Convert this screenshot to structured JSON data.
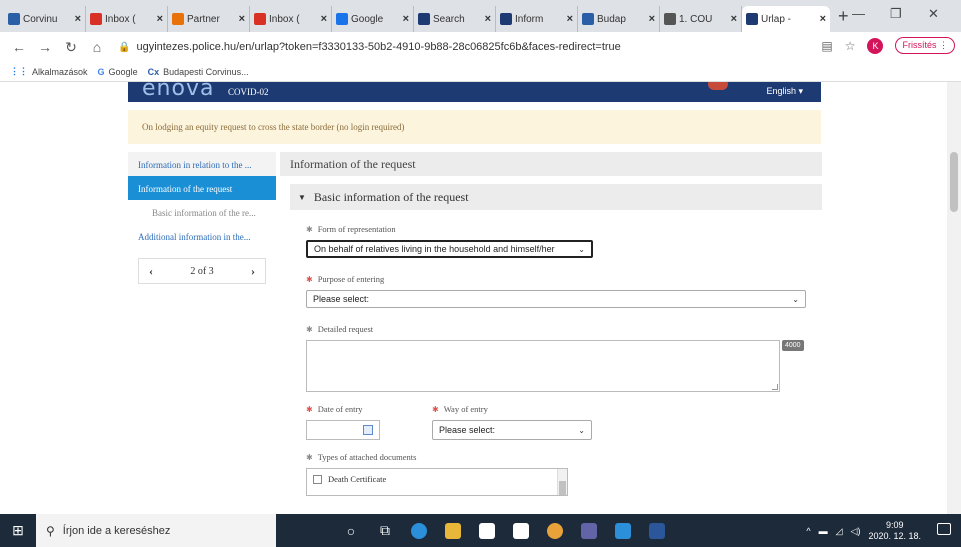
{
  "browser": {
    "tabs": [
      {
        "label": "Corvinu",
        "icon": "corvinus-icon",
        "color": "#2a5fa8"
      },
      {
        "label": "Inbox (",
        "icon": "gmail-icon",
        "color": "#d93025"
      },
      {
        "label": "Partner",
        "icon": "partner-icon",
        "color": "#e8710a"
      },
      {
        "label": "Inbox (",
        "icon": "gmail-icon",
        "color": "#d93025"
      },
      {
        "label": "Google",
        "icon": "google-icon",
        "color": "#1a73e8"
      },
      {
        "label": "Search",
        "icon": "search-icon",
        "color": "#1e3a73"
      },
      {
        "label": "Inform",
        "icon": "info-icon",
        "color": "#1e3a73"
      },
      {
        "label": "Budap",
        "icon": "corvinus-icon",
        "color": "#2a5fa8"
      },
      {
        "label": "1. COU",
        "icon": "globe-icon",
        "color": "#555555"
      },
      {
        "label": "Űrlap -",
        "icon": "form-icon",
        "color": "#1e3a73"
      }
    ],
    "url": "ugyintezes.police.hu/en/urlap?token=f3330133-50b2-4910-9b88-28c06825fc6b&faces-redirect=true",
    "profile_initial": "K",
    "refresh_label": "Frissítés",
    "bookmarks": [
      {
        "label": "Alkalmazások",
        "icon": "apps-icon"
      },
      {
        "label": "Google",
        "icon": "google-icon"
      },
      {
        "label": "Budapesti Corvinus...",
        "icon": "corvinus-icon"
      }
    ]
  },
  "site": {
    "logo": "enova",
    "subtitle": "COVID-02",
    "language": "English ▾",
    "notice": "On lodging an equity request to cross the state border (no login required)"
  },
  "leftnav": {
    "items": [
      {
        "label": "Information in relation to the ...",
        "state": "link"
      },
      {
        "label": "Information of the request",
        "state": "active"
      },
      {
        "label": "Basic information of the re...",
        "state": "sub"
      },
      {
        "label": "Additional information in the...",
        "state": "link"
      }
    ],
    "pager": "2 of 3"
  },
  "main": {
    "title": "Information of the request",
    "section": "Basic information of the request",
    "form_of_representation": {
      "label": "Form of representation",
      "value": "On behalf of relatives living in the household and himself/her"
    },
    "purpose": {
      "label": "Purpose of entering",
      "value": "Please select:"
    },
    "detailed_request": {
      "label": "Detailed request",
      "counter": "4000"
    },
    "date_of_entry": {
      "label": "Date of entry"
    },
    "way_of_entry": {
      "label": "Way of entry",
      "value": "Please select:"
    },
    "documents": {
      "label": "Types of attached documents",
      "items": [
        "Death Certificate"
      ]
    }
  },
  "taskbar": {
    "search_placeholder": "Írjon ide a kereséshez",
    "time": "9:09",
    "date": "2020. 12. 18."
  }
}
